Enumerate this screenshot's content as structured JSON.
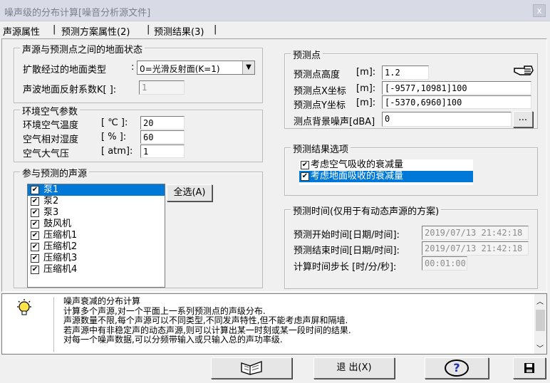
{
  "window": {
    "title": "噪声级的分布计算[噪音分析源文件]",
    "close": "x"
  },
  "tabs": [
    {
      "label": "声源属性"
    },
    {
      "label": "预测方案属性(2)"
    },
    {
      "label": "预测结果(3)"
    }
  ],
  "ground": {
    "title": "声源与预测点之间的地面状态",
    "type_label": "扩散经过的地面类型",
    "type_colon": ":",
    "type_value": "0=光滑反射面(K=1)",
    "reflect_label": "声波地面反射系数K[ ]:",
    "reflect_value": "1"
  },
  "air": {
    "title": "环境空气参数",
    "temp_label": "环境空气温度",
    "temp_unit": "[ ℃ ]:",
    "temp_value": "20",
    "humidity_label": "空气相对湿度",
    "humidity_unit": "[  % ]:",
    "humidity_value": "60",
    "pressure_label": "空气大气压",
    "pressure_unit": "[ atm]:",
    "pressure_value": "1"
  },
  "sources": {
    "title": "参与预测的声源",
    "select_all": "全选(A)",
    "items": [
      {
        "label": "泵1",
        "checked": true,
        "selected": true
      },
      {
        "label": "泵2",
        "checked": true
      },
      {
        "label": "泵3",
        "checked": true
      },
      {
        "label": "鼓风机",
        "checked": true
      },
      {
        "label": "压缩机1",
        "checked": true
      },
      {
        "label": "压缩机2",
        "checked": true
      },
      {
        "label": "压缩机3",
        "checked": true
      },
      {
        "label": "压缩机4",
        "checked": true
      }
    ]
  },
  "point": {
    "title": "预测点",
    "height_label": "预测点高度",
    "height_unit": "[m]:",
    "height_value": "1.2",
    "x_label": "预测点X坐标",
    "x_unit": "[m]:",
    "x_value": "[-9577,10981]100",
    "y_label": "预测点Y坐标",
    "y_unit": "[m]:",
    "y_value": "[-5370,6960]100",
    "bg_label": "测点背景噪声[dBA]",
    "bg_value": "0",
    "browse": "..."
  },
  "options": {
    "title": "预测结果选项",
    "items": [
      {
        "label": "考虑空气吸收的衰减量",
        "checked": true
      },
      {
        "label": "考虑地面吸收的衰减量",
        "checked": true,
        "selected": true
      }
    ]
  },
  "time": {
    "title": "预测时间(仅用于有动态声源的方案)",
    "start_label": "预测开始时间[日期/时间]:",
    "start_value": "2019/07/13 21:42:18",
    "end_label": "预测结束时间[日期/时间]:",
    "end_value": "2019/07/13 21:42:18",
    "step_label": "计算时间步长 [时/分/秒]:",
    "step_value": "00:01:00"
  },
  "help": {
    "lines": [
      "噪声衰减的分布计算",
      "计算多个声源,对一个平面上一系列预测点的声级分布.",
      "声源数量不限,每个声源可以不同类型,不同发声特性,但不能考虑声屏和隔墙.",
      "若声源中有非稳定声的动态声源,则可以计算出某一时刻或某一段时间的结果.",
      "对每一个噪声数据,可以分频带输入或只输入总的声功率级."
    ]
  },
  "footer": {
    "exit": "退 出(X)",
    "help": "?"
  }
}
